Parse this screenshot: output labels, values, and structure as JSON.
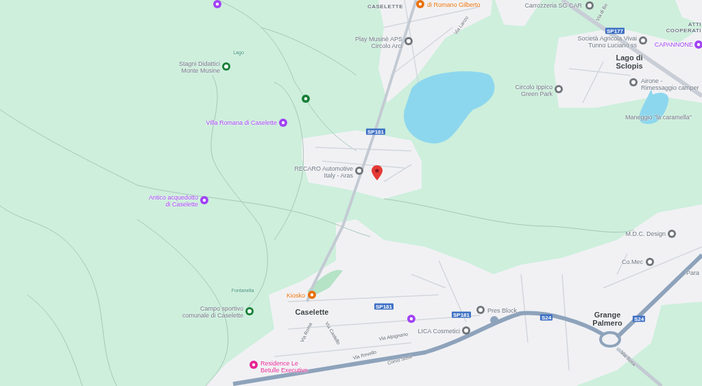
{
  "map": {
    "places": [
      {
        "lines": [
          "di Romano Gilberto"
        ],
        "kind": "poi-tinted",
        "color": "#e8710a"
      },
      {
        "lines": [
          "CASELETTE"
        ],
        "kind": "area"
      },
      {
        "lines": [
          "Carrozzeria SG CAR"
        ],
        "kind": "poi",
        "color": "#70757a"
      },
      {
        "lines": [
          "Via Lanzo"
        ],
        "kind": "road"
      },
      {
        "lines": [
          "Via di Bo"
        ],
        "kind": "road"
      },
      {
        "lines": [
          "ATTI",
          "COOPERATI"
        ],
        "kind": "area"
      },
      {
        "lines": [
          "Società Agricola Vivai",
          "Tunno Luciano ss"
        ],
        "kind": "poi",
        "color": "#70757a"
      },
      {
        "lines": [
          "CAPANNONE"
        ],
        "kind": "poi-tinted",
        "color": "#a142f4"
      },
      {
        "lines": [
          "Lago di",
          "Sclopis"
        ],
        "kind": "town"
      },
      {
        "lines": [
          "Airone -",
          "Rimessaggio camper"
        ],
        "kind": "poi",
        "color": "#70757a"
      },
      {
        "lines": [
          "Circolo Ippico",
          "Green Park"
        ],
        "kind": "poi",
        "color": "#70757a"
      },
      {
        "lines": [
          "Maneggio \"la caramella\""
        ],
        "kind": "plain"
      },
      {
        "lines": [
          "Play Musinè APS",
          "Circolo Arci"
        ],
        "kind": "poi",
        "color": "#70757a"
      },
      {
        "lines": [
          "Lago"
        ],
        "kind": "water"
      },
      {
        "lines": [
          "Stagni Didattici",
          "Monte Musine"
        ],
        "kind": "poi",
        "color": "#188038"
      },
      {
        "lines": [
          "Villa Romana di Caselette"
        ],
        "kind": "poi-tinted",
        "color": "#a142f4"
      },
      {
        "lines": [
          "RECARO Automotive",
          "Italy - Aras"
        ],
        "kind": "poi",
        "color": "#70757a"
      },
      {
        "lines": [
          "Antico acquedotto",
          "di Caselette"
        ],
        "kind": "poi-tinted",
        "color": "#a142f4"
      },
      {
        "lines": [
          "M.D.C. Design"
        ],
        "kind": "poi",
        "color": "#70757a"
      },
      {
        "lines": [
          "Co.Mec"
        ],
        "kind": "poi",
        "color": "#70757a"
      },
      {
        "lines": [
          "Para"
        ],
        "kind": "plain"
      },
      {
        "lines": [
          "Pres Block"
        ],
        "kind": "poi",
        "color": "#70757a"
      },
      {
        "lines": [
          "LICA Cosmetici"
        ],
        "kind": "poi",
        "color": "#70757a"
      },
      {
        "lines": [
          "Grange",
          "Palmero"
        ],
        "kind": "town"
      },
      {
        "lines": [
          "Via Susa"
        ],
        "kind": "road"
      },
      {
        "lines": [
          "Fontanella"
        ],
        "kind": "water"
      },
      {
        "lines": [
          "Kiosko"
        ],
        "kind": "poi-tinted",
        "color": "#e8710a"
      },
      {
        "lines": [
          "Campo sportivo",
          "comunale di Caselette"
        ],
        "kind": "poi",
        "color": "#188038"
      },
      {
        "lines": [
          "Caselette"
        ],
        "kind": "town"
      },
      {
        "lines": [
          "Via Roma"
        ],
        "kind": "road"
      },
      {
        "lines": [
          "Via Castello"
        ],
        "kind": "road"
      },
      {
        "lines": [
          "Via Alpignano"
        ],
        "kind": "road"
      },
      {
        "lines": [
          "Via Revello"
        ],
        "kind": "road"
      },
      {
        "lines": [
          "Corso Susa"
        ],
        "kind": "road"
      },
      {
        "lines": [
          "Residence Le",
          "Betulle Executive"
        ],
        "kind": "poi-tinted",
        "color": "#e52592"
      }
    ],
    "shields": [
      "SP181",
      "SP177",
      "SP181",
      "SP181",
      "S24",
      "S24"
    ]
  }
}
